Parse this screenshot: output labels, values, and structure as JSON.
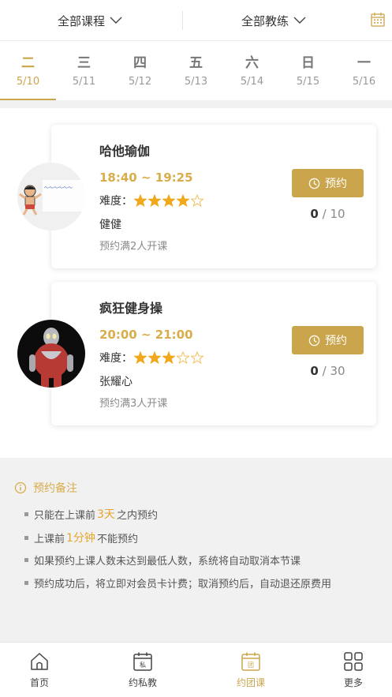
{
  "filters": {
    "course": "全部课程",
    "coach": "全部教练"
  },
  "calendar_icon": "calendar-icon",
  "days": [
    {
      "name": "二",
      "date": "5/10",
      "active": true
    },
    {
      "name": "三",
      "date": "5/11",
      "active": false
    },
    {
      "name": "四",
      "date": "5/12",
      "active": false
    },
    {
      "name": "五",
      "date": "5/13",
      "active": false
    },
    {
      "name": "六",
      "date": "5/14",
      "active": false
    },
    {
      "name": "日",
      "date": "5/15",
      "active": false
    },
    {
      "name": "一",
      "date": "5/16",
      "active": false
    }
  ],
  "courses": [
    {
      "title": "哈他瑜伽",
      "time": "18:40 ~ 19:25",
      "difficulty_label": "难度：",
      "difficulty": 4,
      "difficulty_max": 5,
      "coach": "健健",
      "note": "预约满2人开课",
      "book_label": "预约",
      "booked": "0",
      "capacity": "/ 10"
    },
    {
      "title": "疯狂健身操",
      "time": "20:00 ~ 21:00",
      "difficulty_label": "难度：",
      "difficulty": 3,
      "difficulty_max": 5,
      "coach": "张耀心",
      "note": "预约满3人开课",
      "book_label": "预约",
      "booked": "0",
      "capacity": "/ 30"
    }
  ],
  "notes": {
    "title": "预约备注",
    "line1": {
      "pre": "只能在上课前",
      "hl": "3天",
      "post": "之内预约"
    },
    "line2": {
      "pre": "上课前",
      "hl": "1分钟",
      "post": "不能预约"
    },
    "line3": "如果预约上课人数未达到最低人数，系统将自动取消本节课",
    "line4": "预约成功后，将立即对会员卡计费；取消预约后，自动退还原费用"
  },
  "nav": [
    {
      "label": "首页",
      "icon": "home-icon"
    },
    {
      "label": "约私教",
      "icon": "private-calendar-icon"
    },
    {
      "label": "约团课",
      "icon": "group-calendar-icon",
      "active": true
    },
    {
      "label": "更多",
      "icon": "grid-icon"
    }
  ],
  "colors": {
    "accent": "#cba54c",
    "time": "#d9ad4a",
    "highlight": "#e6a52d"
  }
}
